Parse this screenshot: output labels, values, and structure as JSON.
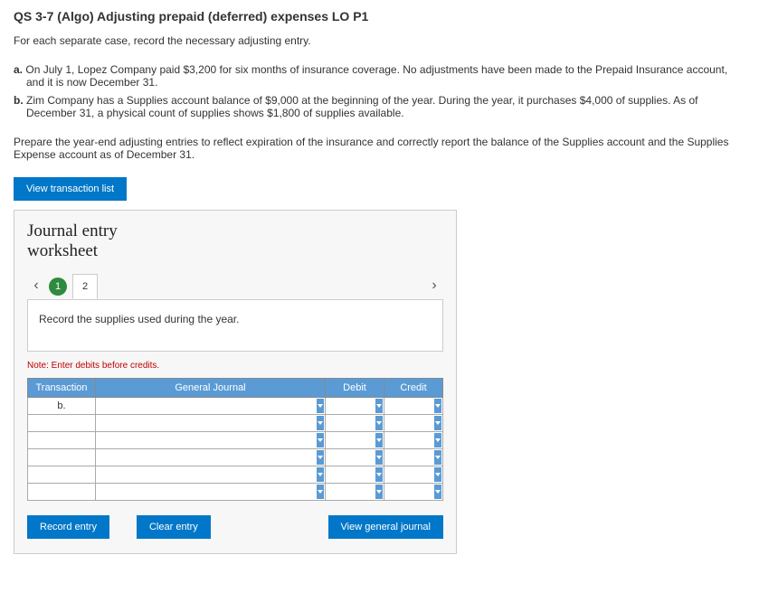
{
  "title": "QS 3-7 (Algo) Adjusting prepaid (deferred) expenses LO P1",
  "intro": "For each separate case, record the necessary adjusting entry.",
  "cases": [
    {
      "marker": "a.",
      "text": "On July 1, Lopez Company paid $3,200 for six months of insurance coverage. No adjustments have been made to the Prepaid Insurance account, and it is now December 31."
    },
    {
      "marker": "b.",
      "text": "Zim Company has a Supplies account balance of $9,000 at the beginning of the year. During the year, it purchases $4,000 of supplies. As of December 31, a physical count of supplies shows $1,800 of supplies available."
    }
  ],
  "prepare": "Prepare the year-end adjusting entries to reflect expiration of the insurance and correctly report the balance of the Supplies account and the Supplies Expense account as of December 31.",
  "buttons": {
    "view_list": "View transaction list",
    "record": "Record entry",
    "clear": "Clear entry",
    "view_journal": "View general journal"
  },
  "worksheet": {
    "title_line1": "Journal entry",
    "title_line2": "worksheet",
    "tabs": [
      "1",
      "2"
    ],
    "active_tab_index": 0,
    "instruction": "Record the supplies used during the year.",
    "note": "Note: Enter debits before credits.",
    "headers": {
      "transaction": "Transaction",
      "general_journal": "General Journal",
      "debit": "Debit",
      "credit": "Credit"
    },
    "rows": [
      {
        "transaction": "b.",
        "gj": "",
        "debit": "",
        "credit": ""
      },
      {
        "transaction": "",
        "gj": "",
        "debit": "",
        "credit": ""
      },
      {
        "transaction": "",
        "gj": "",
        "debit": "",
        "credit": ""
      },
      {
        "transaction": "",
        "gj": "",
        "debit": "",
        "credit": ""
      },
      {
        "transaction": "",
        "gj": "",
        "debit": "",
        "credit": ""
      },
      {
        "transaction": "",
        "gj": "",
        "debit": "",
        "credit": ""
      }
    ]
  }
}
